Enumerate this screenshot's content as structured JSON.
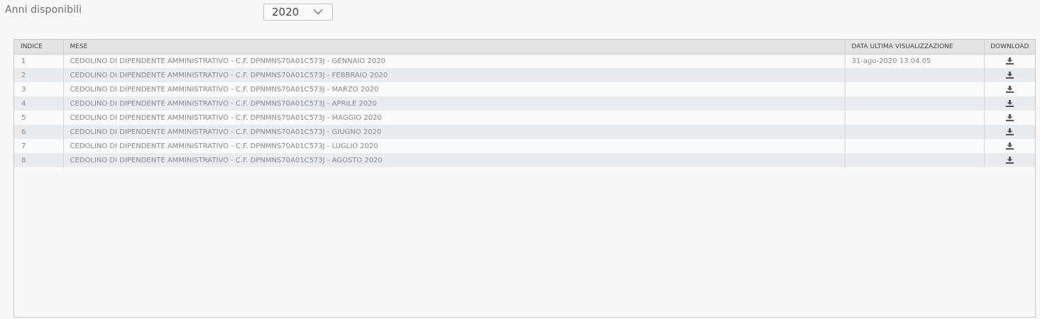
{
  "filter": {
    "label": "Anni disponibili",
    "selected_year": "2020"
  },
  "table": {
    "columns": [
      "INDICE",
      "MESE",
      "DATA ULTIMA VISUALIZZAZIONE",
      "DOWNLOAD"
    ],
    "rows": [
      {
        "index": "1",
        "month": "CEDOLINO DI DIPENDENTE AMMINISTRATIVO - C.F. DPNMNS70A01C573J - GENNAIO 2020",
        "last_view": "31-ago-2020 13.04.05",
        "download_icon": "download-icon"
      },
      {
        "index": "2",
        "month": "CEDOLINO DI DIPENDENTE AMMINISTRATIVO - C.F. DPNMNS70A01C573J - FEBBRAIO 2020",
        "last_view": "",
        "download_icon": "download-icon"
      },
      {
        "index": "3",
        "month": "CEDOLINO DI DIPENDENTE AMMINISTRATIVO - C.F. DPNMNS70A01C573J - MARZO 2020",
        "last_view": "",
        "download_icon": "download-icon"
      },
      {
        "index": "4",
        "month": "CEDOLINO DI DIPENDENTE AMMINISTRATIVO - C.F. DPNMNS70A01C573J - APRILE 2020",
        "last_view": "",
        "download_icon": "download-icon"
      },
      {
        "index": "5",
        "month": "CEDOLINO DI DIPENDENTE AMMINISTRATIVO - C.F. DPNMNS70A01C573J - MAGGIO 2020",
        "last_view": "",
        "download_icon": "download-icon"
      },
      {
        "index": "6",
        "month": "CEDOLINO DI DIPENDENTE AMMINISTRATIVO - C.F. DPNMNS70A01C573J - GIUGNO 2020",
        "last_view": "",
        "download_icon": "download-icon"
      },
      {
        "index": "7",
        "month": "CEDOLINO DI DIPENDENTE AMMINISTRATIVO - C.F. DPNMNS70A01C573J - LUGLIO 2020",
        "last_view": "",
        "download_icon": "download-icon"
      },
      {
        "index": "8",
        "month": "CEDOLINO DI DIPENDENTE AMMINISTRATIVO - C.F. DPNMNS70A01C573J - AGOSTO 2020",
        "last_view": "",
        "download_icon": "download-icon"
      }
    ]
  },
  "colors": {
    "header_bg": "#e4e4e4",
    "row_odd": "#fafafa",
    "row_even": "#e9ebee",
    "text": "#8a8a8a",
    "icon": "#555555"
  }
}
